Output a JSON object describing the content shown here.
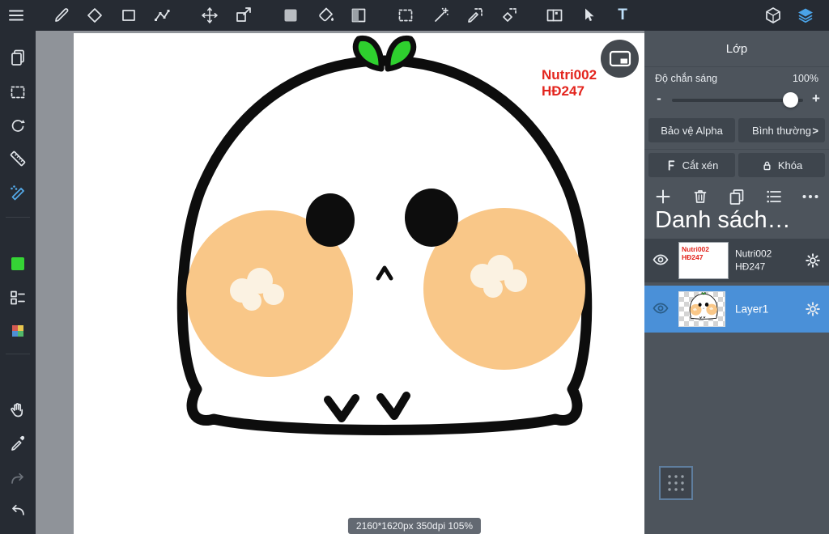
{
  "toolbar": {
    "text_tool_glyph": "T",
    "tools": [
      "menu",
      "brush",
      "eraser",
      "rectangle",
      "polyline",
      "move",
      "transform",
      "color-swatch",
      "paint-bucket",
      "gradient",
      "marquee-select",
      "magic-wand",
      "select-pen",
      "select-eraser",
      "panels",
      "cursor",
      "text",
      "3d-view",
      "layers"
    ]
  },
  "left_toolbar": {
    "tools": [
      "pages",
      "marquee-select",
      "rotate-view",
      "ruler",
      "airbrush",
      "foreground-color",
      "layer-list",
      "color-palette",
      "hand",
      "eyedropper",
      "redo",
      "undo"
    ],
    "active_tool": "airbrush",
    "foreground_color": "#35d435"
  },
  "canvas": {
    "watermark": {
      "line1": "Nutri002",
      "line2": "HĐ247",
      "color": "#e3241d"
    },
    "status": "2160*1620px 350dpi 105%"
  },
  "right_panel": {
    "title": "Lớp",
    "opacity": {
      "label": "Độ chắn sáng",
      "value": "100%",
      "minus": "-",
      "plus": "+",
      "percent": 100
    },
    "buttons": {
      "alpha": "Bảo vệ Alpha",
      "blend": "Bình thường",
      "blend_chevron": ">",
      "clip": "Cắt xén",
      "lock": "Khóa"
    },
    "list_title": "Danh sách…",
    "layers": [
      {
        "thumb_line1": "Nutri002",
        "thumb_line2": "HĐ247",
        "name_line1": "Nutri002",
        "name_line2": "HĐ247",
        "selected": false
      },
      {
        "name": "Layer1",
        "selected": true
      }
    ]
  },
  "colors": {
    "selection_blue": "#4a90d8",
    "tool_blue": "#54a9e8",
    "cheek": "#f9c788",
    "leaf_green": "#2ed02e",
    "watermark_red": "#e3241d",
    "panel_gray": "#4d545c",
    "bar_dark": "#262b33"
  }
}
